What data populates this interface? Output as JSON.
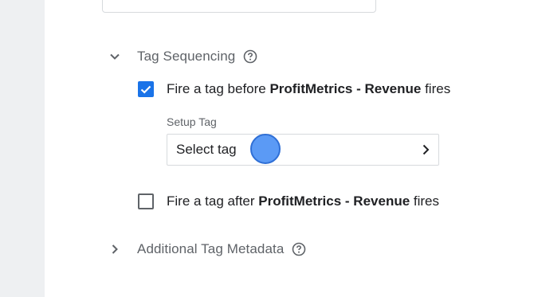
{
  "tag_sequencing": {
    "title": "Tag Sequencing",
    "help_icon": "help-circle-icon",
    "fire_before": {
      "checked": true,
      "prefix": "Fire a tag before ",
      "tag_name": "ProfitMetrics - Revenue",
      "suffix": " fires"
    },
    "setup_tag": {
      "label": "Setup Tag",
      "value": "Select tag"
    },
    "fire_after": {
      "checked": false,
      "prefix": "Fire a tag after ",
      "tag_name": "ProfitMetrics - Revenue",
      "suffix": " fires"
    }
  },
  "additional_metadata": {
    "title": "Additional Tag Metadata",
    "help_icon": "help-circle-icon"
  },
  "colors": {
    "accent": "#1a73e8",
    "cursor": "#5b9af5"
  }
}
